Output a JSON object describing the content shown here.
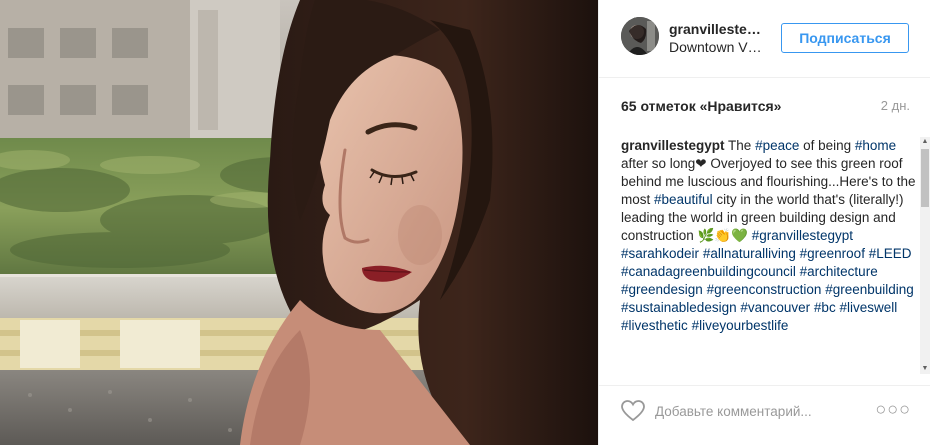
{
  "post": {
    "image_alt": "Photo of a woman with long dark hair looking down in front of a green roof",
    "author": {
      "username": "granvilleste…",
      "location": "Downtown V…",
      "follow_label": "Подписаться"
    },
    "likes_text": "65 отметок «Нравится»",
    "time_ago": "2 дн.",
    "caption": {
      "username": "granvillestegypt",
      "segments": [
        {
          "type": "text",
          "value": "The "
        },
        {
          "type": "tag",
          "value": "#peace"
        },
        {
          "type": "text",
          "value": " of being "
        },
        {
          "type": "tag",
          "value": "#home"
        },
        {
          "type": "text",
          "value": " after so long❤ Overjoyed to see this green roof behind me luscious and flourishing...Here's to the most "
        },
        {
          "type": "tag",
          "value": "#beautiful"
        },
        {
          "type": "text",
          "value": " city in the world that's (literally!) leading the world in green building design and construction 🌿👏💚 "
        },
        {
          "type": "tag",
          "value": "#granvillestegypt"
        },
        {
          "type": "text",
          "value": " "
        },
        {
          "type": "tag",
          "value": "#sarahkodeir"
        },
        {
          "type": "text",
          "value": " "
        },
        {
          "type": "tag",
          "value": "#allnaturalliving"
        },
        {
          "type": "text",
          "value": " "
        },
        {
          "type": "tag",
          "value": "#greenroof"
        },
        {
          "type": "text",
          "value": " "
        },
        {
          "type": "tag",
          "value": "#LEED"
        },
        {
          "type": "text",
          "value": " "
        },
        {
          "type": "tag",
          "value": "#canadagreenbuildingcouncil"
        },
        {
          "type": "text",
          "value": " "
        },
        {
          "type": "tag",
          "value": "#architecture"
        },
        {
          "type": "text",
          "value": " "
        },
        {
          "type": "tag",
          "value": "#greendesign"
        },
        {
          "type": "text",
          "value": " "
        },
        {
          "type": "tag",
          "value": "#greenconstruction"
        },
        {
          "type": "text",
          "value": " "
        },
        {
          "type": "tag",
          "value": "#greenbuilding"
        },
        {
          "type": "text",
          "value": " "
        },
        {
          "type": "tag",
          "value": "#sustainabledesign"
        },
        {
          "type": "text",
          "value": " "
        },
        {
          "type": "tag",
          "value": "#vancouver"
        },
        {
          "type": "text",
          "value": " "
        },
        {
          "type": "tag",
          "value": "#bc"
        },
        {
          "type": "text",
          "value": " "
        },
        {
          "type": "tag",
          "value": "#liveswell"
        },
        {
          "type": "text",
          "value": " "
        },
        {
          "type": "tag",
          "value": "#livesthetic"
        },
        {
          "type": "text",
          "value": " "
        },
        {
          "type": "tag",
          "value": "#liveyourbestlife"
        }
      ]
    },
    "comment": {
      "placeholder": "Добавьте комментарий...",
      "more_label": "○○○"
    }
  },
  "icons": {
    "heart": "heart-outline-icon",
    "more": "more-options-icon",
    "scroll_up": "▲",
    "scroll_down": "▼"
  },
  "colors": {
    "accent": "#3897f0",
    "hashtag": "#003569",
    "muted": "#999999",
    "text": "#262626"
  }
}
